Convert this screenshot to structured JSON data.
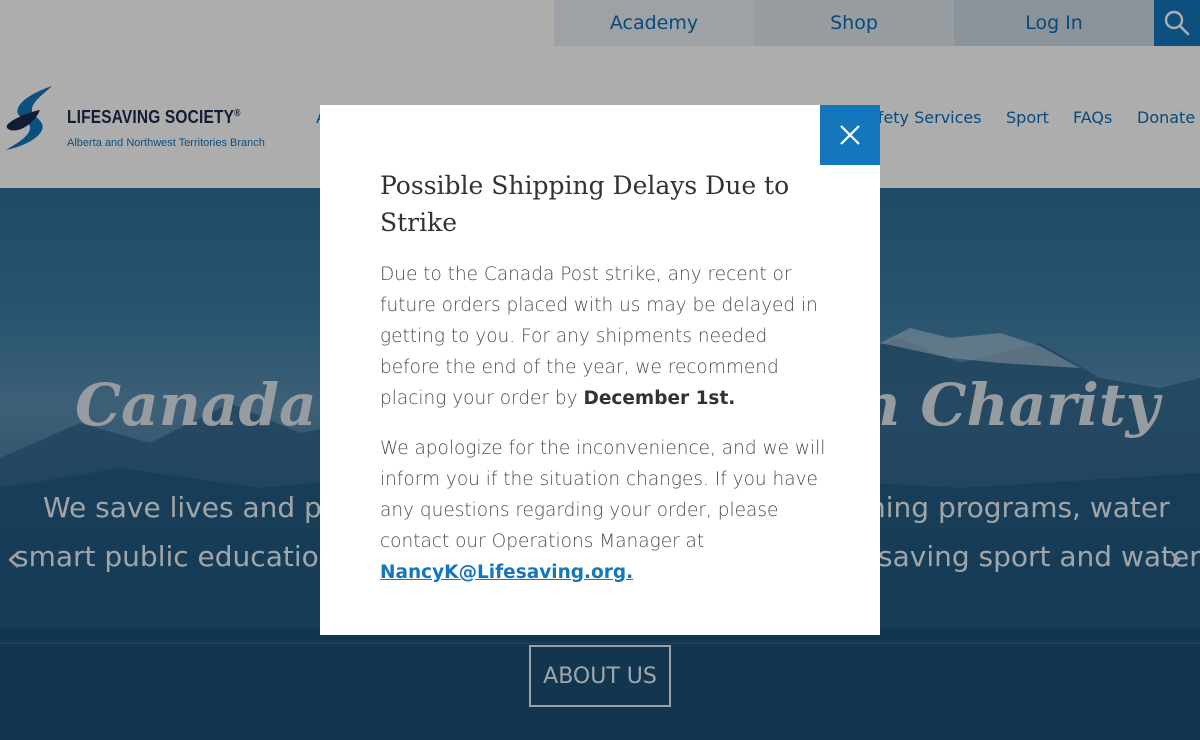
{
  "topbar": {
    "academy": "Academy",
    "shop": "Shop",
    "login": "Log In",
    "search_icon": "search-icon"
  },
  "logo": {
    "name": "LIFESAVING SOCIETY",
    "registered": "®",
    "branch": "Alberta and Northwest Territories Branch"
  },
  "nav": {
    "partial_left": "A",
    "safety_services": "afety Services",
    "sport": "Sport",
    "faqs": "FAQs",
    "donate": "Donate"
  },
  "hero": {
    "title_left": "Canada's",
    "title_right": "n Charity",
    "line1_left": "We save lives and pr",
    "line1_right": "ning programs, water",
    "line2_left": "smart public education",
    "line2_right": "saving sport and water",
    "prev_arrow": "‹",
    "next_arrow": "›",
    "about_button": "ABOUT US"
  },
  "modal": {
    "title": "Possible Shipping Delays Due to Strike",
    "para1_text": "Due to the Canada Post strike, any recent or future orders placed with us may be delayed in getting to you. For any shipments needed before the end of the year, we recommend placing your order by",
    "para1_bold": "December 1st.",
    "para2_text": "We apologize for the inconvenience, and we will inform you if the situation changes. If you have any questions regarding your order, please contact our Operations Manager at",
    "para2_link": "NancyK@Lifesaving.org.",
    "close_icon": "close-icon"
  },
  "colors": {
    "brand_blue": "#1477bd",
    "dark_navy": "#1a2b4a"
  }
}
